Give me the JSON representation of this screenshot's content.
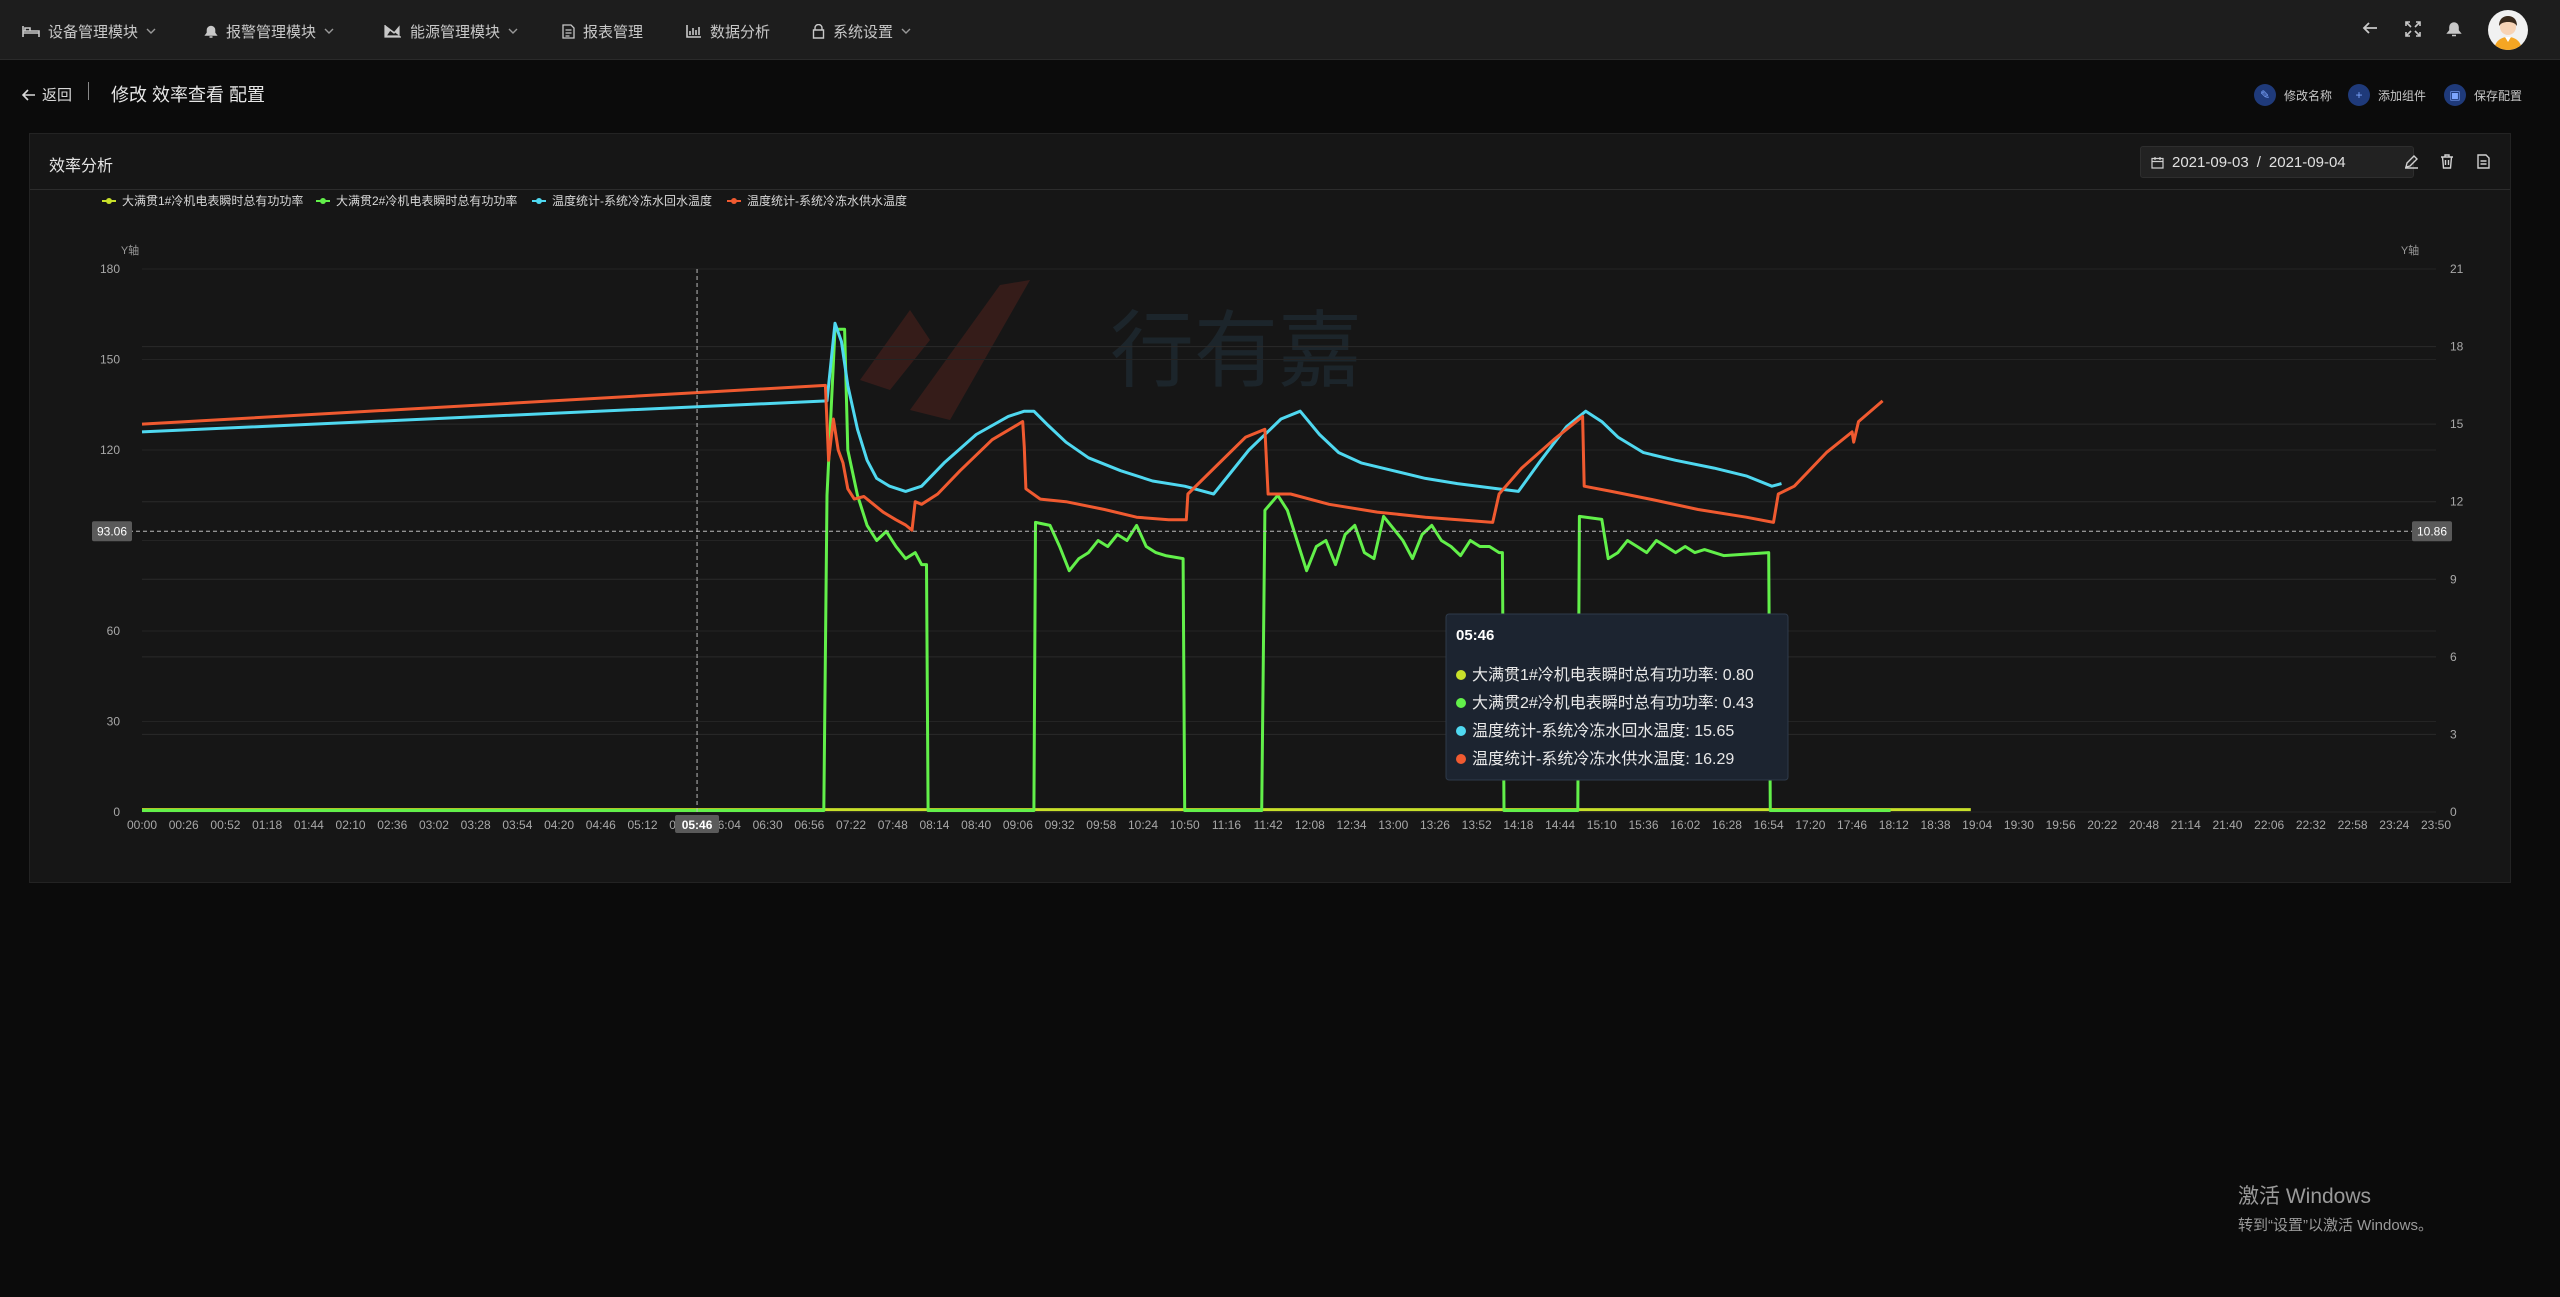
{
  "nav": {
    "items": [
      {
        "label": "设备管理模块",
        "icon": "bed-icon",
        "dropdown": true
      },
      {
        "label": "报警管理模块",
        "icon": "bell-icon",
        "dropdown": true
      },
      {
        "label": "能源管理模块",
        "icon": "area-chart-icon",
        "dropdown": true
      },
      {
        "label": "报表管理",
        "icon": "document-icon",
        "dropdown": false
      },
      {
        "label": "数据分析",
        "icon": "bar-chart-icon",
        "dropdown": false
      },
      {
        "label": "系统设置",
        "icon": "lock-icon",
        "dropdown": true
      }
    ],
    "right_icons": [
      "back-arrow-icon",
      "fullscreen-icon",
      "notification-bell-icon",
      "user-avatar"
    ]
  },
  "subheader": {
    "back_label": "返回",
    "title": "修改 效率查看 配置",
    "actions": [
      {
        "label": "修改名称",
        "icon": "edit-icon"
      },
      {
        "label": "添加组件",
        "icon": "plus-icon"
      },
      {
        "label": "保存配置",
        "icon": "save-icon"
      }
    ]
  },
  "panel": {
    "title": "效率分析",
    "date_start": "2021-09-03",
    "date_sep": "/",
    "date_end": "2021-09-04"
  },
  "colors": {
    "series1": "#c8e02a",
    "series2": "#62f04a",
    "series3": "#4fd8f0",
    "series4": "#f05a30",
    "axis_badge": "#5a5a5a"
  },
  "chart_data": {
    "type": "line",
    "left_axis": {
      "name": "Y轴",
      "range": [
        0,
        180
      ],
      "ticks": [
        0,
        30,
        60,
        90,
        120,
        150,
        180
      ],
      "tick_labels": [
        "0",
        "30",
        "60",
        "",
        "120",
        "150",
        "180"
      ]
    },
    "right_axis": {
      "name": "Y轴",
      "range": [
        0,
        21
      ],
      "ticks": [
        0,
        3,
        6,
        9,
        12,
        15,
        18,
        21
      ],
      "tick_labels": [
        "0",
        "3",
        "6",
        "9",
        "12",
        "15",
        "18",
        "21"
      ]
    },
    "x_labels": [
      "00:00",
      "00:26",
      "00:52",
      "01:18",
      "01:44",
      "02:10",
      "02:36",
      "03:02",
      "03:28",
      "03:54",
      "04:20",
      "04:46",
      "05:12",
      "05:38",
      "06:04",
      "06:30",
      "06:56",
      "07:22",
      "07:48",
      "08:14",
      "08:40",
      "09:06",
      "09:32",
      "09:58",
      "10:24",
      "10:50",
      "11:16",
      "11:42",
      "12:08",
      "12:34",
      "13:00",
      "13:26",
      "13:52",
      "14:18",
      "14:44",
      "15:10",
      "15:36",
      "16:02",
      "16:28",
      "16:54",
      "17:20",
      "17:46",
      "18:12",
      "18:38",
      "19:04",
      "19:30",
      "19:56",
      "20:22",
      "20:48",
      "21:14",
      "21:40",
      "22:06",
      "22:32",
      "22:58",
      "23:24",
      "23:50"
    ],
    "legend": [
      "大满贯1#冷机电表瞬时总有功功率",
      "大满贯2#冷机电表瞬时总有功功率",
      "温度统计-系统冷冻水回水温度",
      "温度统计-系统冷冻水供水温度"
    ],
    "series": [
      {
        "name": "大满贯1#冷机电表瞬时总有功功率",
        "axis": "left",
        "points": [
          [
            0,
            0.8
          ],
          [
            1140,
            0.8
          ]
        ]
      },
      {
        "name": "大满贯2#冷机电表瞬时总有功功率",
        "axis": "left",
        "points": [
          [
            0,
            0.5
          ],
          [
            425,
            0.5
          ],
          [
            427,
            105
          ],
          [
            432,
            160
          ],
          [
            438,
            160
          ],
          [
            440,
            120
          ],
          [
            446,
            105
          ],
          [
            452,
            95
          ],
          [
            458,
            90
          ],
          [
            464,
            93
          ],
          [
            470,
            88
          ],
          [
            476,
            84
          ],
          [
            482,
            86
          ],
          [
            486,
            82
          ],
          [
            489,
            82
          ],
          [
            490,
            0.5
          ],
          [
            556,
            0.5
          ],
          [
            557,
            96
          ],
          [
            566,
            95
          ],
          [
            572,
            88
          ],
          [
            578,
            80
          ],
          [
            584,
            84
          ],
          [
            590,
            86
          ],
          [
            596,
            90
          ],
          [
            602,
            88
          ],
          [
            608,
            92
          ],
          [
            614,
            90
          ],
          [
            620,
            95
          ],
          [
            626,
            88
          ],
          [
            632,
            86
          ],
          [
            638,
            85
          ],
          [
            649,
            84
          ],
          [
            650,
            0.5
          ],
          [
            698,
            0.5
          ],
          [
            700,
            100
          ],
          [
            708,
            105
          ],
          [
            714,
            100
          ],
          [
            720,
            90
          ],
          [
            726,
            80
          ],
          [
            732,
            88
          ],
          [
            738,
            90
          ],
          [
            744,
            82
          ],
          [
            750,
            92
          ],
          [
            756,
            95
          ],
          [
            762,
            86
          ],
          [
            768,
            84
          ],
          [
            774,
            98
          ],
          [
            780,
            94
          ],
          [
            786,
            90
          ],
          [
            792,
            84
          ],
          [
            798,
            92
          ],
          [
            804,
            95
          ],
          [
            810,
            90
          ],
          [
            816,
            88
          ],
          [
            822,
            85
          ],
          [
            828,
            90
          ],
          [
            834,
            88
          ],
          [
            840,
            88
          ],
          [
            846,
            86
          ],
          [
            848,
            86
          ],
          [
            849,
            0.5
          ],
          [
            895,
            0.5
          ],
          [
            896,
            98
          ],
          [
            910,
            97
          ],
          [
            914,
            84
          ],
          [
            920,
            86
          ],
          [
            926,
            90
          ],
          [
            932,
            88
          ],
          [
            938,
            86
          ],
          [
            944,
            90
          ],
          [
            950,
            88
          ],
          [
            956,
            86
          ],
          [
            962,
            88
          ],
          [
            968,
            86
          ],
          [
            974,
            87
          ],
          [
            980,
            86
          ],
          [
            986,
            85
          ],
          [
            1014,
            86
          ],
          [
            1015,
            0.5
          ],
          [
            1090,
            0.5
          ]
        ]
      },
      {
        "name": "温度统计-系统冷冻水回水温度",
        "axis": "right",
        "points": [
          [
            0,
            14.7
          ],
          [
            427,
            15.9
          ],
          [
            432,
            18.9
          ],
          [
            436,
            18.2
          ],
          [
            440,
            16.5
          ],
          [
            446,
            14.8
          ],
          [
            452,
            13.6
          ],
          [
            458,
            12.9
          ],
          [
            466,
            12.6
          ],
          [
            476,
            12.4
          ],
          [
            486,
            12.6
          ],
          [
            500,
            13.5
          ],
          [
            520,
            14.6
          ],
          [
            540,
            15.3
          ],
          [
            550,
            15.5
          ],
          [
            556,
            15.5
          ],
          [
            564,
            15.0
          ],
          [
            576,
            14.3
          ],
          [
            590,
            13.7
          ],
          [
            610,
            13.2
          ],
          [
            630,
            12.8
          ],
          [
            650,
            12.6
          ],
          [
            668,
            12.3
          ],
          [
            690,
            14.0
          ],
          [
            710,
            15.2
          ],
          [
            722,
            15.5
          ],
          [
            734,
            14.6
          ],
          [
            746,
            13.9
          ],
          [
            760,
            13.5
          ],
          [
            780,
            13.2
          ],
          [
            800,
            12.9
          ],
          [
            820,
            12.7
          ],
          [
            845,
            12.5
          ],
          [
            858,
            12.4
          ],
          [
            872,
            13.6
          ],
          [
            888,
            14.9
          ],
          [
            900,
            15.5
          ],
          [
            910,
            15.1
          ],
          [
            920,
            14.5
          ],
          [
            936,
            13.9
          ],
          [
            956,
            13.6
          ],
          [
            980,
            13.3
          ],
          [
            1000,
            13.0
          ],
          [
            1016,
            12.6
          ],
          [
            1022,
            12.7
          ]
        ]
      },
      {
        "name": "温度统计-系统冷冻水供水温度",
        "axis": "right",
        "points": [
          [
            0,
            15.0
          ],
          [
            426,
            16.5
          ],
          [
            428,
            13.6
          ],
          [
            431,
            15.2
          ],
          [
            434,
            14.0
          ],
          [
            437,
            13.5
          ],
          [
            440,
            12.5
          ],
          [
            444,
            12.1
          ],
          [
            450,
            12.2
          ],
          [
            456,
            11.9
          ],
          [
            462,
            11.6
          ],
          [
            470,
            11.3
          ],
          [
            476,
            11.1
          ],
          [
            480,
            10.9
          ],
          [
            482,
            12.0
          ],
          [
            486,
            11.9
          ],
          [
            496,
            12.3
          ],
          [
            510,
            13.2
          ],
          [
            530,
            14.4
          ],
          [
            549,
            15.1
          ],
          [
            550,
            14.1
          ],
          [
            551,
            12.5
          ],
          [
            560,
            12.1
          ],
          [
            576,
            12.0
          ],
          [
            600,
            11.7
          ],
          [
            620,
            11.4
          ],
          [
            640,
            11.3
          ],
          [
            651,
            11.3
          ],
          [
            652,
            12.3
          ],
          [
            670,
            13.4
          ],
          [
            688,
            14.5
          ],
          [
            700,
            14.8
          ],
          [
            702,
            12.3
          ],
          [
            716,
            12.3
          ],
          [
            740,
            11.9
          ],
          [
            770,
            11.6
          ],
          [
            800,
            11.4
          ],
          [
            842,
            11.2
          ],
          [
            846,
            12.3
          ],
          [
            860,
            13.3
          ],
          [
            880,
            14.4
          ],
          [
            898,
            15.3
          ],
          [
            899,
            12.6
          ],
          [
            916,
            12.4
          ],
          [
            940,
            12.1
          ],
          [
            970,
            11.7
          ],
          [
            1000,
            11.4
          ],
          [
            1017,
            11.2
          ],
          [
            1020,
            12.3
          ],
          [
            1030,
            12.6
          ],
          [
            1050,
            13.9
          ],
          [
            1066,
            14.7
          ],
          [
            1067,
            14.3
          ],
          [
            1070,
            15.1
          ],
          [
            1085,
            15.9
          ]
        ]
      }
    ],
    "crosshair": {
      "x_label": "05:46",
      "left_value_label": "93.06",
      "right_value_label": "10.86"
    },
    "tooltip": {
      "title": "05:46",
      "rows": [
        {
          "label": "大满贯1#冷机电表瞬时总有功功率",
          "value": "0.80"
        },
        {
          "label": "大满贯2#冷机电表瞬时总有功功率",
          "value": "0.43"
        },
        {
          "label": "温度统计-系统冷冻水回水温度",
          "value": "15.65"
        },
        {
          "label": "温度统计-系统冷冻水供水温度",
          "value": "16.29"
        }
      ]
    },
    "grid": true,
    "legend_position": "top-left"
  },
  "windows_activation": {
    "line1": "激活 Windows",
    "line2": "转到“设置”以激活 Windows。"
  }
}
